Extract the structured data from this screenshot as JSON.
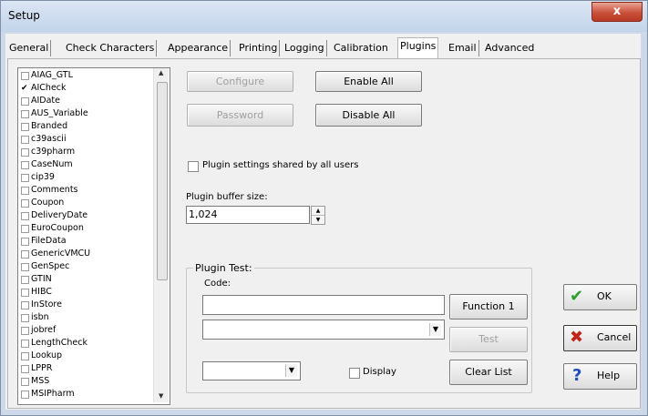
{
  "window": {
    "title": "Setup",
    "close_symbol": "x"
  },
  "tabs": [
    {
      "label": "General"
    },
    {
      "label": "Check Characters"
    },
    {
      "label": "Appearance"
    },
    {
      "label": "Printing"
    },
    {
      "label": "Logging"
    },
    {
      "label": "Calibration"
    },
    {
      "label": "Plugins"
    },
    {
      "label": "Email"
    },
    {
      "label": "Advanced"
    }
  ],
  "active_tab": "Plugins",
  "plugins": [
    {
      "name": "AIAG_GTL",
      "checked": false
    },
    {
      "name": "AICheck",
      "checked": true
    },
    {
      "name": "AIDate",
      "checked": false
    },
    {
      "name": "AUS_Variable",
      "checked": false
    },
    {
      "name": "Branded",
      "checked": false
    },
    {
      "name": "c39ascii",
      "checked": false
    },
    {
      "name": "c39pharm",
      "checked": false
    },
    {
      "name": "CaseNum",
      "checked": false
    },
    {
      "name": "cip39",
      "checked": false
    },
    {
      "name": "Comments",
      "checked": false
    },
    {
      "name": "Coupon",
      "checked": false
    },
    {
      "name": "DeliveryDate",
      "checked": false
    },
    {
      "name": "EuroCoupon",
      "checked": false
    },
    {
      "name": "FileData",
      "checked": false
    },
    {
      "name": "GenericVMCU",
      "checked": false
    },
    {
      "name": "GenSpec",
      "checked": false
    },
    {
      "name": "GTIN",
      "checked": false
    },
    {
      "name": "HIBC",
      "checked": false
    },
    {
      "name": "InStore",
      "checked": false
    },
    {
      "name": "isbn",
      "checked": false
    },
    {
      "name": "jobref",
      "checked": false
    },
    {
      "name": "LengthCheck",
      "checked": false
    },
    {
      "name": "Lookup",
      "checked": false
    },
    {
      "name": "LPPR",
      "checked": false
    },
    {
      "name": "MSS",
      "checked": false
    },
    {
      "name": "MSIPharm",
      "checked": false
    }
  ],
  "buttons": {
    "configure": "Configure",
    "enable_all": "Enable All",
    "password": "Password",
    "disable_all": "Disable All",
    "function1": "Function 1",
    "test": "Test",
    "clear_list": "Clear List",
    "ok": "OK",
    "cancel": "Cancel",
    "help": "Help"
  },
  "shared_checkbox": {
    "label": "Plugin settings shared by all users",
    "checked": false
  },
  "buffer": {
    "label": "Plugin buffer size:",
    "value": "1,024"
  },
  "plugin_test": {
    "group_title": "Plugin Test:",
    "code_label": "Code:",
    "code_value": "",
    "dropdown_value": "",
    "small_dropdown_value": "",
    "display_label": "Display",
    "display_checked": false
  },
  "icons": {
    "ok": "checkmark-icon",
    "cancel": "x-icon",
    "help": "question-icon",
    "ok_color": "#2e9e2e",
    "cancel_color": "#c0241a",
    "help_color": "#1f4fbf"
  }
}
